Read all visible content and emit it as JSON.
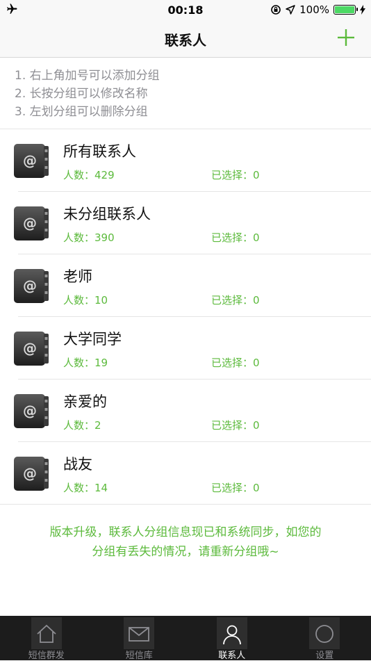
{
  "status_bar": {
    "time": "00:18",
    "battery_percent": "100%",
    "battery_level": 1.0
  },
  "nav": {
    "title": "联系人"
  },
  "tips": [
    "1. 右上角加号可以添加分组",
    "2. 长按分组可以修改名称",
    "3. 左划分组可以删除分组"
  ],
  "groups": [
    {
      "name": "所有联系人",
      "count": "人数：429",
      "selected": "已选择：0"
    },
    {
      "name": "未分组联系人",
      "count": "人数：390",
      "selected": "已选择：0"
    },
    {
      "name": "老师",
      "count": "人数：10",
      "selected": "已选择：0"
    },
    {
      "name": "大学同学",
      "count": "人数：19",
      "selected": "已选择：0"
    },
    {
      "name": "亲爱的",
      "count": "人数：2",
      "selected": "已选择：0"
    },
    {
      "name": "战友",
      "count": "人数：14",
      "selected": "已选择：0"
    }
  ],
  "notice": {
    "line1": "版本升级，联系人分组信息现已和系统同步，如您的",
    "line2": "分组有丢失的情况，请重新分组哦~"
  },
  "tabs": [
    {
      "label": "短信群发",
      "icon": "home-icon"
    },
    {
      "label": "短信库",
      "icon": "envelope-icon"
    },
    {
      "label": "联系人",
      "icon": "person-icon",
      "active": true
    },
    {
      "label": "设置",
      "icon": "circle-icon"
    }
  ],
  "colors": {
    "accent": "#5cba3c",
    "tab_bar": "#1c1c1c",
    "battery": "#4cd964"
  }
}
